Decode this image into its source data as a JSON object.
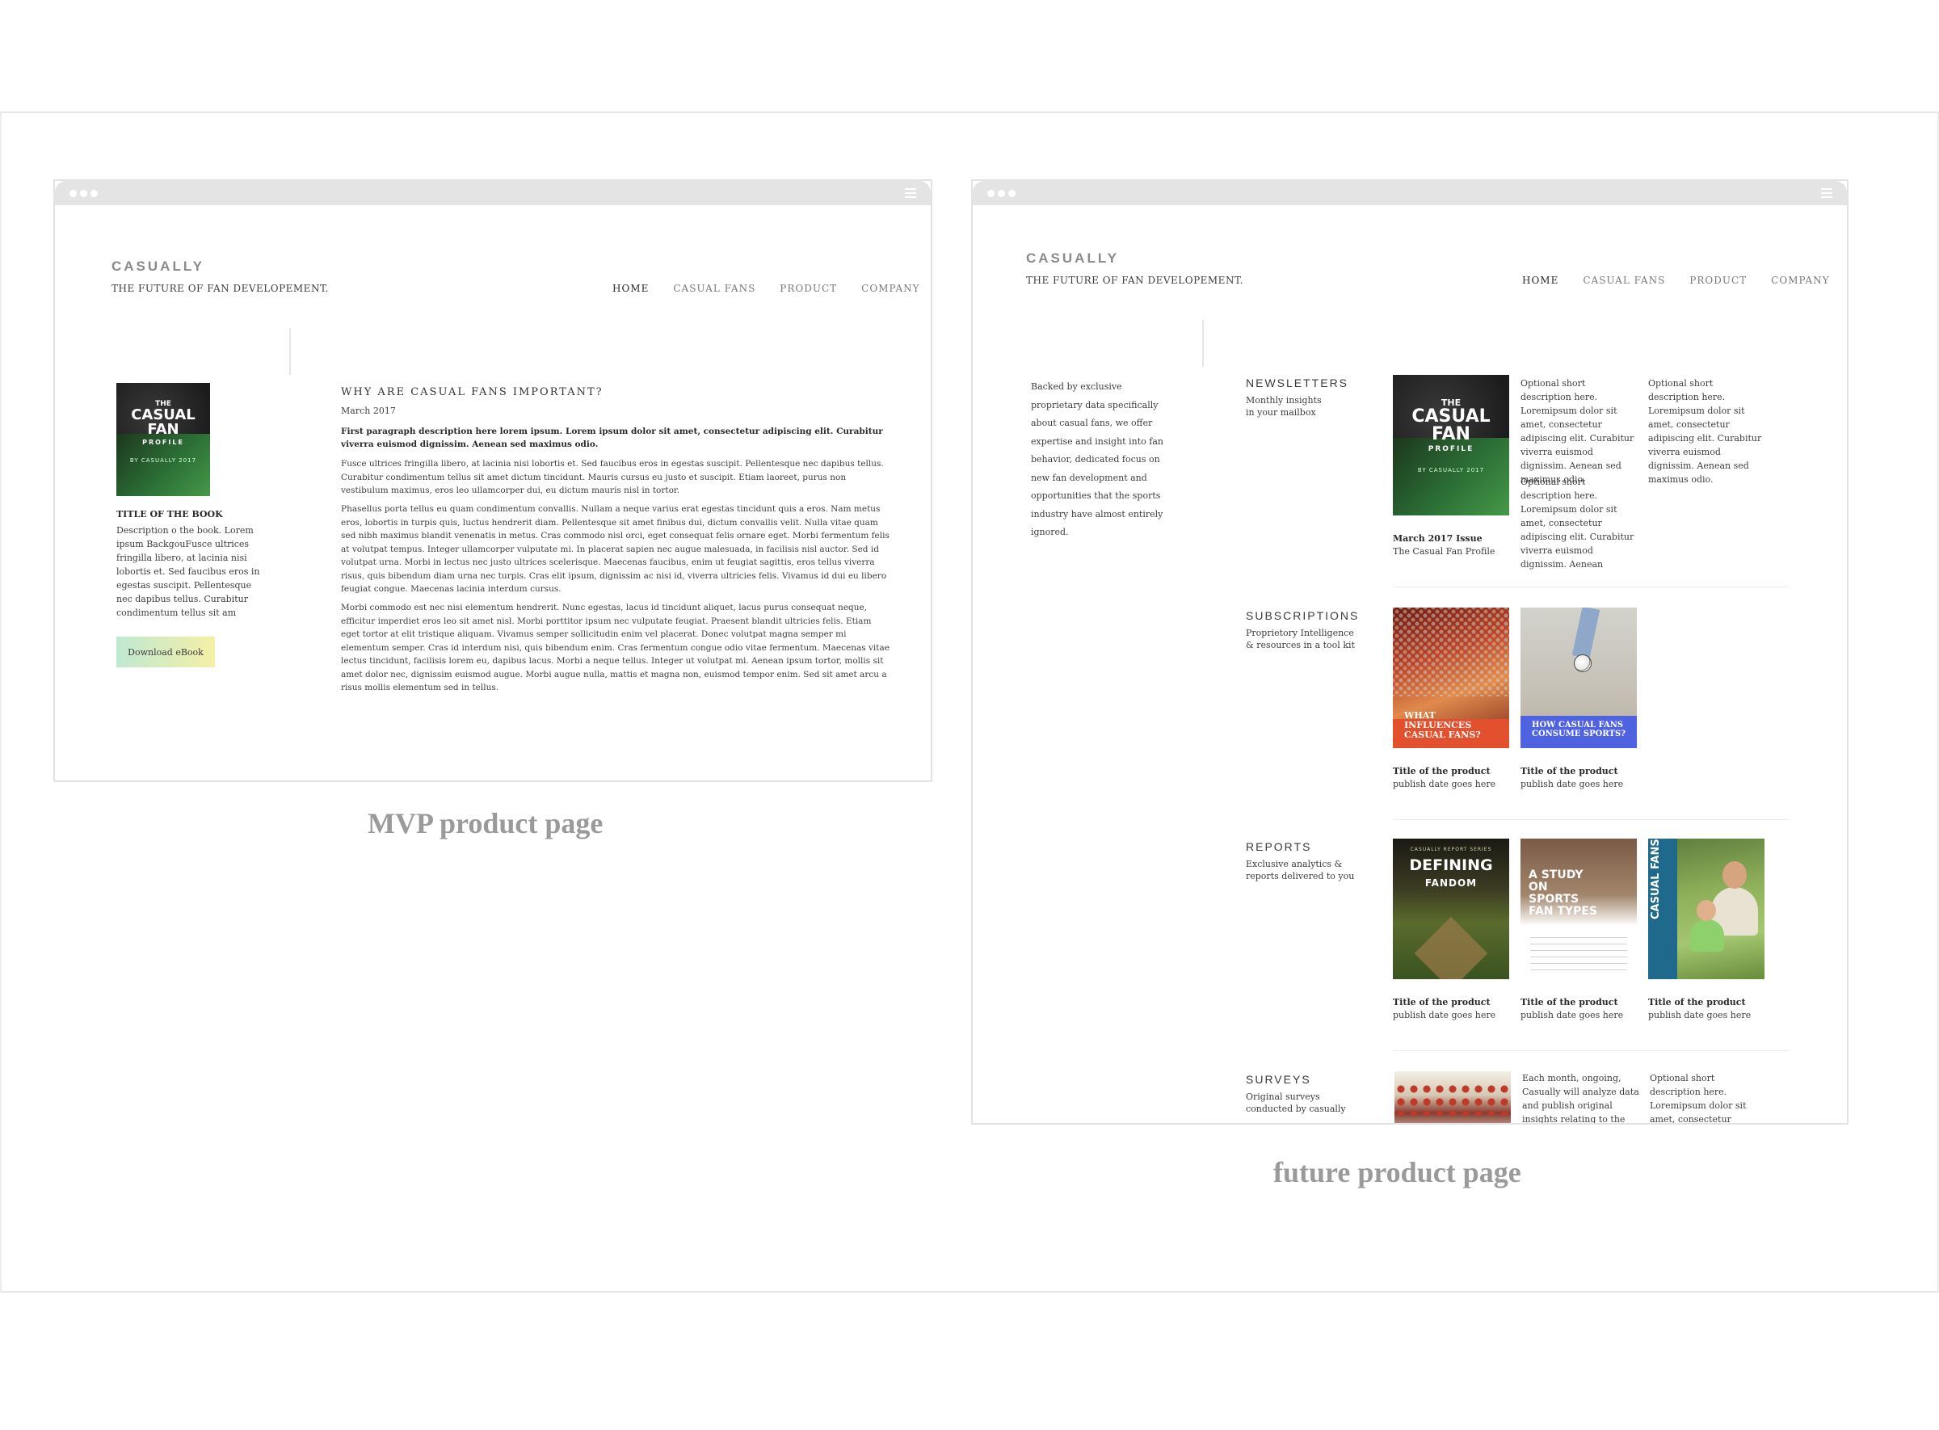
{
  "mvp": {
    "logo": "CASUALLY",
    "tagline": "THE FUTURE OF FAN DEVELOPEMENT.",
    "nav": [
      "HOME",
      "CASUAL FANS",
      "PRODUCT",
      "COMPANY"
    ],
    "book": {
      "cover_title_1": "THE",
      "cover_title_2": "CASUAL",
      "cover_title_3": "FAN",
      "cover_title_4": "PROFILE",
      "cover_sub": "BY CASUALLY 2017",
      "title": "TITLE OF THE BOOK",
      "description": "Description o the book. Lorem ipsum BackgouFusce ultrices fringilla libero, at lacinia nisi lobortis et. Sed faucibus eros in egestas suscipit. Pellentesque nec dapibus tellus. Curabitur condimentum tellus sit am",
      "download_label": "Download eBook"
    },
    "article": {
      "heading": "WHY ARE CASUAL FANS IMPORTANT?",
      "date": "March 2017",
      "lead": "First paragraph description here lorem ipsum. Lorem ipsum dolor sit amet, consectetur adipiscing elit. Curabitur viverra euismod dignissim. Aenean sed maximus odio.",
      "p1": "Fusce ultrices fringilla libero, at lacinia nisi lobortis et. Sed faucibus eros in egestas suscipit. Pellentesque nec dapibus tellus. Curabitur condimentum tellus sit amet dictum tincidunt. Mauris cursus eu justo et suscipit. Etiam laoreet, purus non vestibulum maximus, eros leo ullamcorper dui, eu dictum mauris nisl in tortor.",
      "p2": "Phasellus porta tellus eu quam condimentum convallis. Nullam a neque varius erat egestas tincidunt quis a eros. Nam metus eros, lobortis in turpis quis, luctus hendrerit diam. Pellentesque sit amet finibus dui, dictum convallis velit. Nulla vitae quam sed nibh maximus blandit venenatis in metus. Cras commodo nisl orci, eget consequat felis ornare eget. Morbi fermentum felis at volutpat tempus. Integer ullamcorper vulputate mi. In placerat sapien nec augue malesuada, in facilisis nisl auctor. Sed id volutpat urna. Morbi in lectus nec justo ultrices scelerisque. Maecenas faucibus, enim ut feugiat sagittis, eros tellus viverra risus, quis bibendum diam urna nec turpis. Cras elit ipsum, dignissim ac nisi id, viverra ultricies felis. Vivamus id dui eu libero feugiat congue. Maecenas lacinia interdum cursus.",
      "p3": "Morbi commodo est nec nisi elementum hendrerit. Nunc egestas, lacus id tincidunt aliquet, lacus purus consequat neque, efficitur imperdiet eros leo sit amet nisl. Morbi porttitor ipsum nec vulputate feugiat. Praesent blandit ultricies felis. Etiam eget tortor at elit tristique aliquam. Vivamus semper sollicitudin enim vel placerat. Donec volutpat magna semper mi elementum semper. Cras id interdum nisi, quis bibendum enim. Cras fermentum congue odio vitae fermentum. Maecenas vitae lectus tincidunt, facilisis lorem eu, dapibus lacus. Morbi a neque tellus. Integer ut volutpat mi. Aenean ipsum tortor, mollis sit amet dolor nec, dignissim euismod augue. Morbi augue nulla, mattis et magna non, euismod tempor enim. Sed sit amet arcu a risus mollis elementum sed in tellus."
    },
    "caption": "MVP product page"
  },
  "future": {
    "logo": "CASUALLY",
    "tagline": "THE FUTURE OF FAN DEVELOPEMENT.",
    "nav": [
      "HOME",
      "CASUAL FANS",
      "PRODUCT",
      "COMPANY"
    ],
    "intro": "Backed by exclusive proprietary data specifically about casual fans, we offer expertise and insight into fan behavior, dedicated focus on new fan development and opportunities that the sports industry have almost entirely ignored.",
    "newsletters": {
      "title": "NEWSLETTERS",
      "sub": "Monthly insights in your mailbox",
      "cover": {
        "t1": "THE",
        "t2": "CASUAL",
        "t3": "FAN",
        "t4": "PROFILE",
        "sub": "BY CASUALLY 2017"
      },
      "issue_title": "March 2017 Issue",
      "issue_name": "The Casual Fan Profile",
      "desc1": "Optional short description here. Loremipsum dolor sit amet, consectetur adipiscing elit. Curabitur viverra euismod dignissim. Aenean sed maximus odio.",
      "desc2": "Optional short description here. Loremipsum dolor sit amet, consectetur adipiscing elit. Curabitur viverra euismod dignissim. Aenean",
      "desc3": "Optional short description here. Loremipsum dolor sit amet, consectetur adipiscing elit. Curabitur viverra euismod dignissim. Aenean sed maximus odio."
    },
    "subscriptions": {
      "title": "SUBSCRIPTIONS",
      "sub": "Proprietory Intelligence & resources in a tool kit",
      "items": [
        {
          "cover_text": "WHAT INFLUENCES CASUAL FANS?",
          "title": "Title of the product",
          "date": "publish date goes here"
        },
        {
          "cover_text": "HOW CASUAL FANS CONSUME SPORTS?",
          "title": "Title of the product",
          "date": "publish date goes here"
        }
      ]
    },
    "reports": {
      "title": "REPORTS",
      "sub": "Exclusive analytics & reports delivered to you",
      "items": [
        {
          "cover_tiny": "CASUALLY REPORT SERIES",
          "cover_t1": "DEFINING",
          "cover_t2": "FANDOM",
          "title": "Title of the product",
          "date": "publish date goes here"
        },
        {
          "cover_t1": "A STUDY ON SPORTS FAN TYPES",
          "title": "Title of the product",
          "date": "publish date goes here"
        },
        {
          "cover_t1": "CASUAL FANS",
          "title": "Title of the product",
          "date": "publish date goes here"
        }
      ]
    },
    "surveys": {
      "title": "SURVEYS",
      "sub": "Original surveys conducted by casually",
      "desc1": "Each month, ongoing, Casually will analyze data and publish original insights relating to the big",
      "desc2": "Optional short description here. Loremipsum dolor sit amet, consectetur adipiscing elit. Curabitur"
    },
    "caption": "future product page"
  }
}
